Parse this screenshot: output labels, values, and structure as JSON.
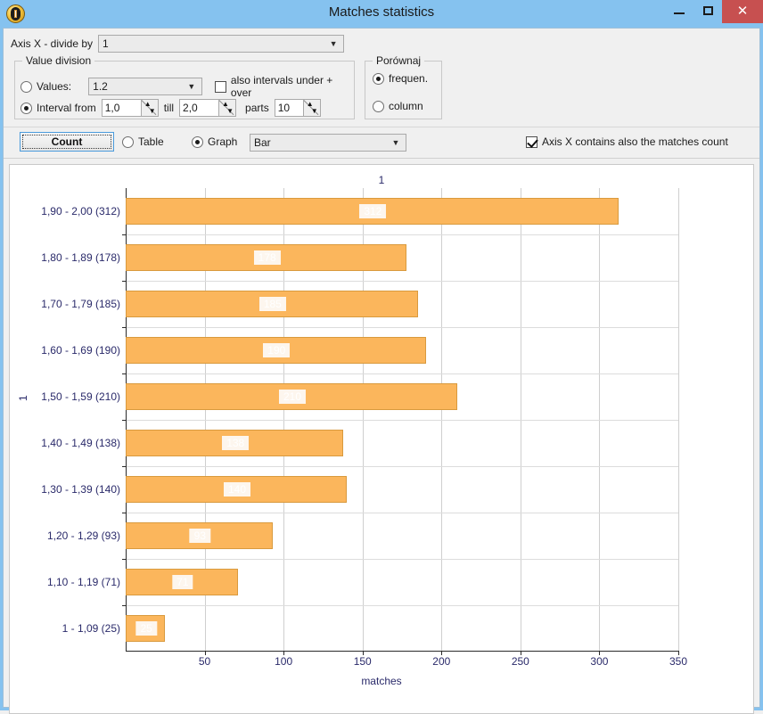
{
  "window": {
    "title": "Matches statistics",
    "app_icon": "medal-icon",
    "minimize_label": "–",
    "maximize_label": "❐",
    "close_label": "✕"
  },
  "controls": {
    "axis_x_divide_label": "Axis X - divide by",
    "axis_x_divide_value": "1",
    "value_division": {
      "group_title": "Value division",
      "values_radio_label": "Values:",
      "values_radio_selected": false,
      "values_combo_value": "1.2",
      "also_intervals_label": "also intervals under  + over",
      "also_intervals_checked": false,
      "interval_radio_label": "Interval from",
      "interval_radio_selected": true,
      "interval_from": "1,0",
      "till_label": "till",
      "interval_till": "2,0",
      "parts_label": "parts",
      "parts_value": "10"
    },
    "porownaj": {
      "group_title": "Porównaj",
      "frequen_label": "frequen.",
      "frequen_selected": true,
      "column_label": "column",
      "column_selected": false
    }
  },
  "toolbar": {
    "count_button": "Count",
    "table_radio_label": "Table",
    "table_selected": false,
    "graph_radio_label": "Graph",
    "graph_selected": true,
    "graph_type_value": "Bar",
    "axis_x_matches_count_label": "Axis X contains also the matches count",
    "axis_x_matches_count_checked": true
  },
  "chart_data": {
    "type": "bar",
    "orientation": "horizontal",
    "title": "1",
    "xlabel": "matches",
    "ylabel": "1",
    "xlim": [
      0,
      350
    ],
    "xticks": [
      50,
      100,
      150,
      200,
      250,
      300,
      350
    ],
    "grid": true,
    "legend_position": "top",
    "bar_color": "#fbb65c",
    "bar_border_color": "#d99a3e",
    "categories": [
      "1,90 - 2,00 (312)",
      "1,80 - 1,89 (178)",
      "1,70 - 1,79 (185)",
      "1,60 - 1,69 (190)",
      "1,50 - 1,59 (210)",
      "1,40 - 1,49 (138)",
      "1,30 - 1,39 (140)",
      "1,20 - 1,29 (93)",
      "1,10 - 1,19 (71)",
      "1 - 1,09 (25)"
    ],
    "values": [
      312,
      178,
      185,
      190,
      210,
      138,
      140,
      93,
      71,
      25
    ]
  }
}
